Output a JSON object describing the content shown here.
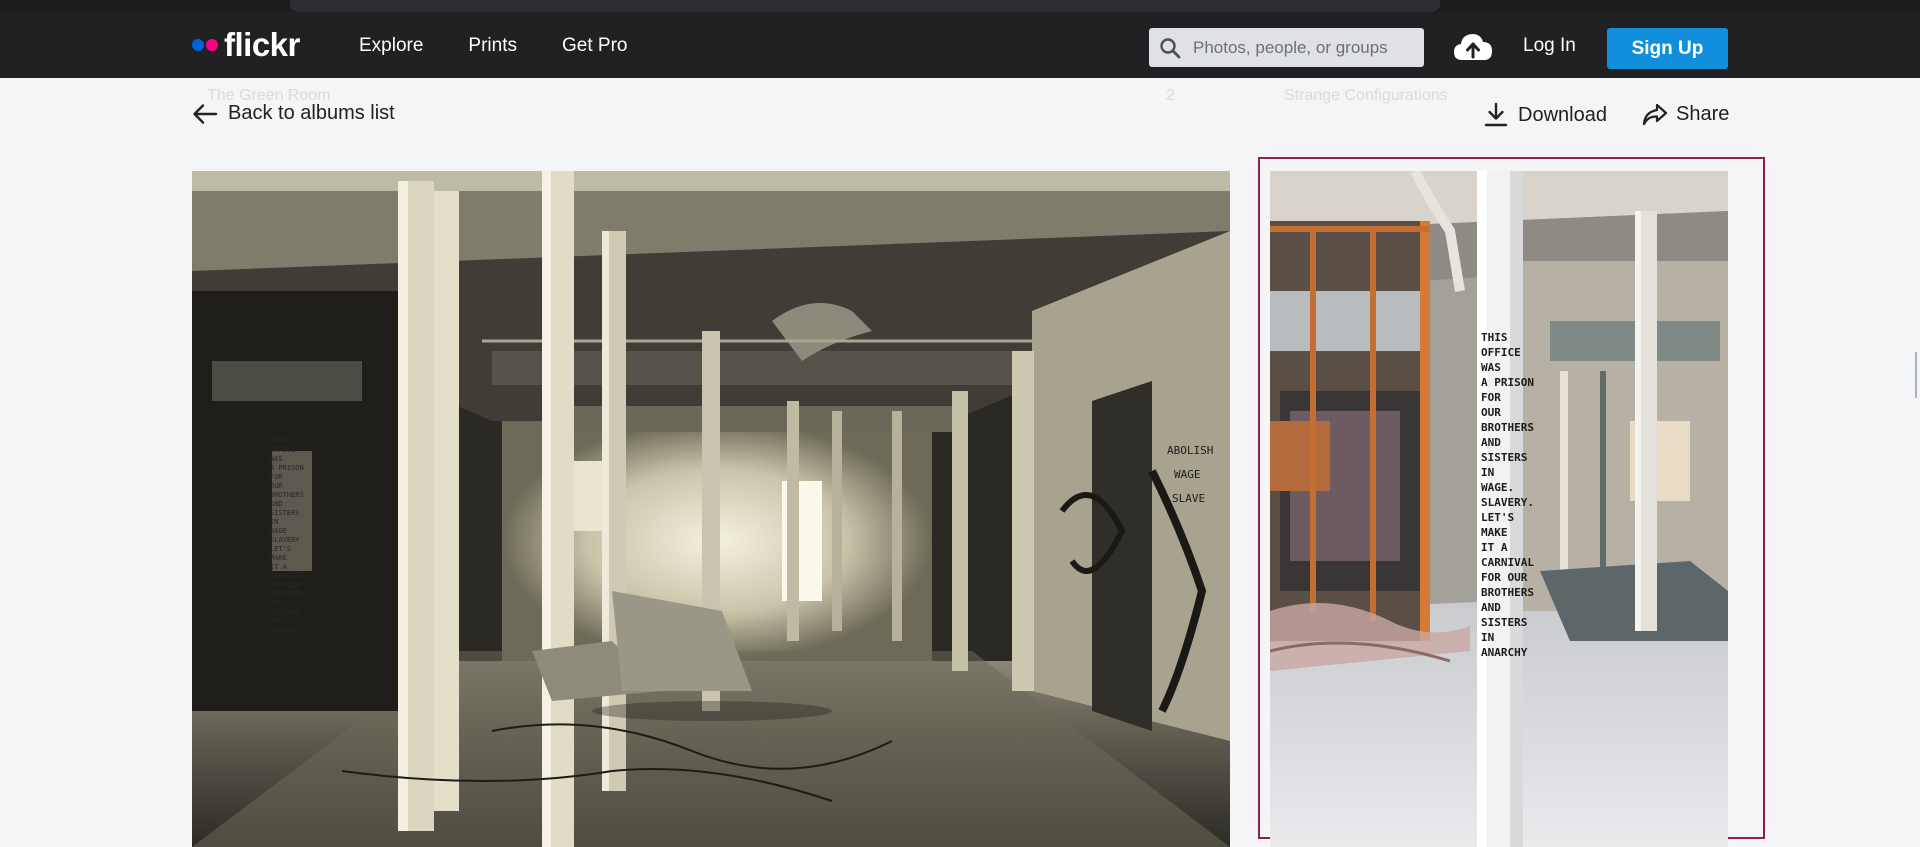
{
  "header": {
    "logo_text": "flickr",
    "nav": [
      "Explore",
      "Prints",
      "Get Pro"
    ],
    "search_placeholder": "Photos, people, or groups",
    "login_label": "Log In",
    "signup_label": "Sign Up"
  },
  "background_titles": {
    "left": "The Green Room",
    "left_count": "2",
    "right": "Strange Configurations"
  },
  "toolbar": {
    "back_label": "Back to albums list",
    "download_label": "Download",
    "share_label": "Share"
  },
  "photos": {
    "main_graffiti": [
      "THIS",
      "OFFICE",
      "WAS",
      "A PRISON",
      "FOR",
      "OUR",
      "BROTHERS",
      "AND",
      "SISTERS",
      "IN",
      "WAGE",
      "SLAVERY",
      "LET'S",
      "MAKE",
      "IT A",
      "CARNIVAL",
      "FOR OUR",
      "BROTHERS",
      "AND",
      "SISTERS",
      "IN",
      "ANARCHY"
    ],
    "side_graffiti": [
      "THIS",
      "OFFICE",
      "WAS",
      "A PRISON",
      "FOR",
      "OUR",
      "BROTHERS",
      "AND",
      "SISTERS",
      "IN",
      "WAGE.",
      "SLAVERY.",
      "LET'S",
      "MAKE",
      "IT A",
      "CARNIVAL",
      "FOR OUR",
      "BROTHERS",
      "AND",
      "SISTERS",
      "IN",
      "ANARCHY"
    ],
    "wall_graffiti": [
      "ABOLISH",
      "WAGE",
      "SLAVE"
    ]
  },
  "colors": {
    "header_bg": "#212124",
    "signup_blue": "#128fdc",
    "selection_border": "#8f1f4b",
    "page_bg": "#f3f5f6"
  }
}
